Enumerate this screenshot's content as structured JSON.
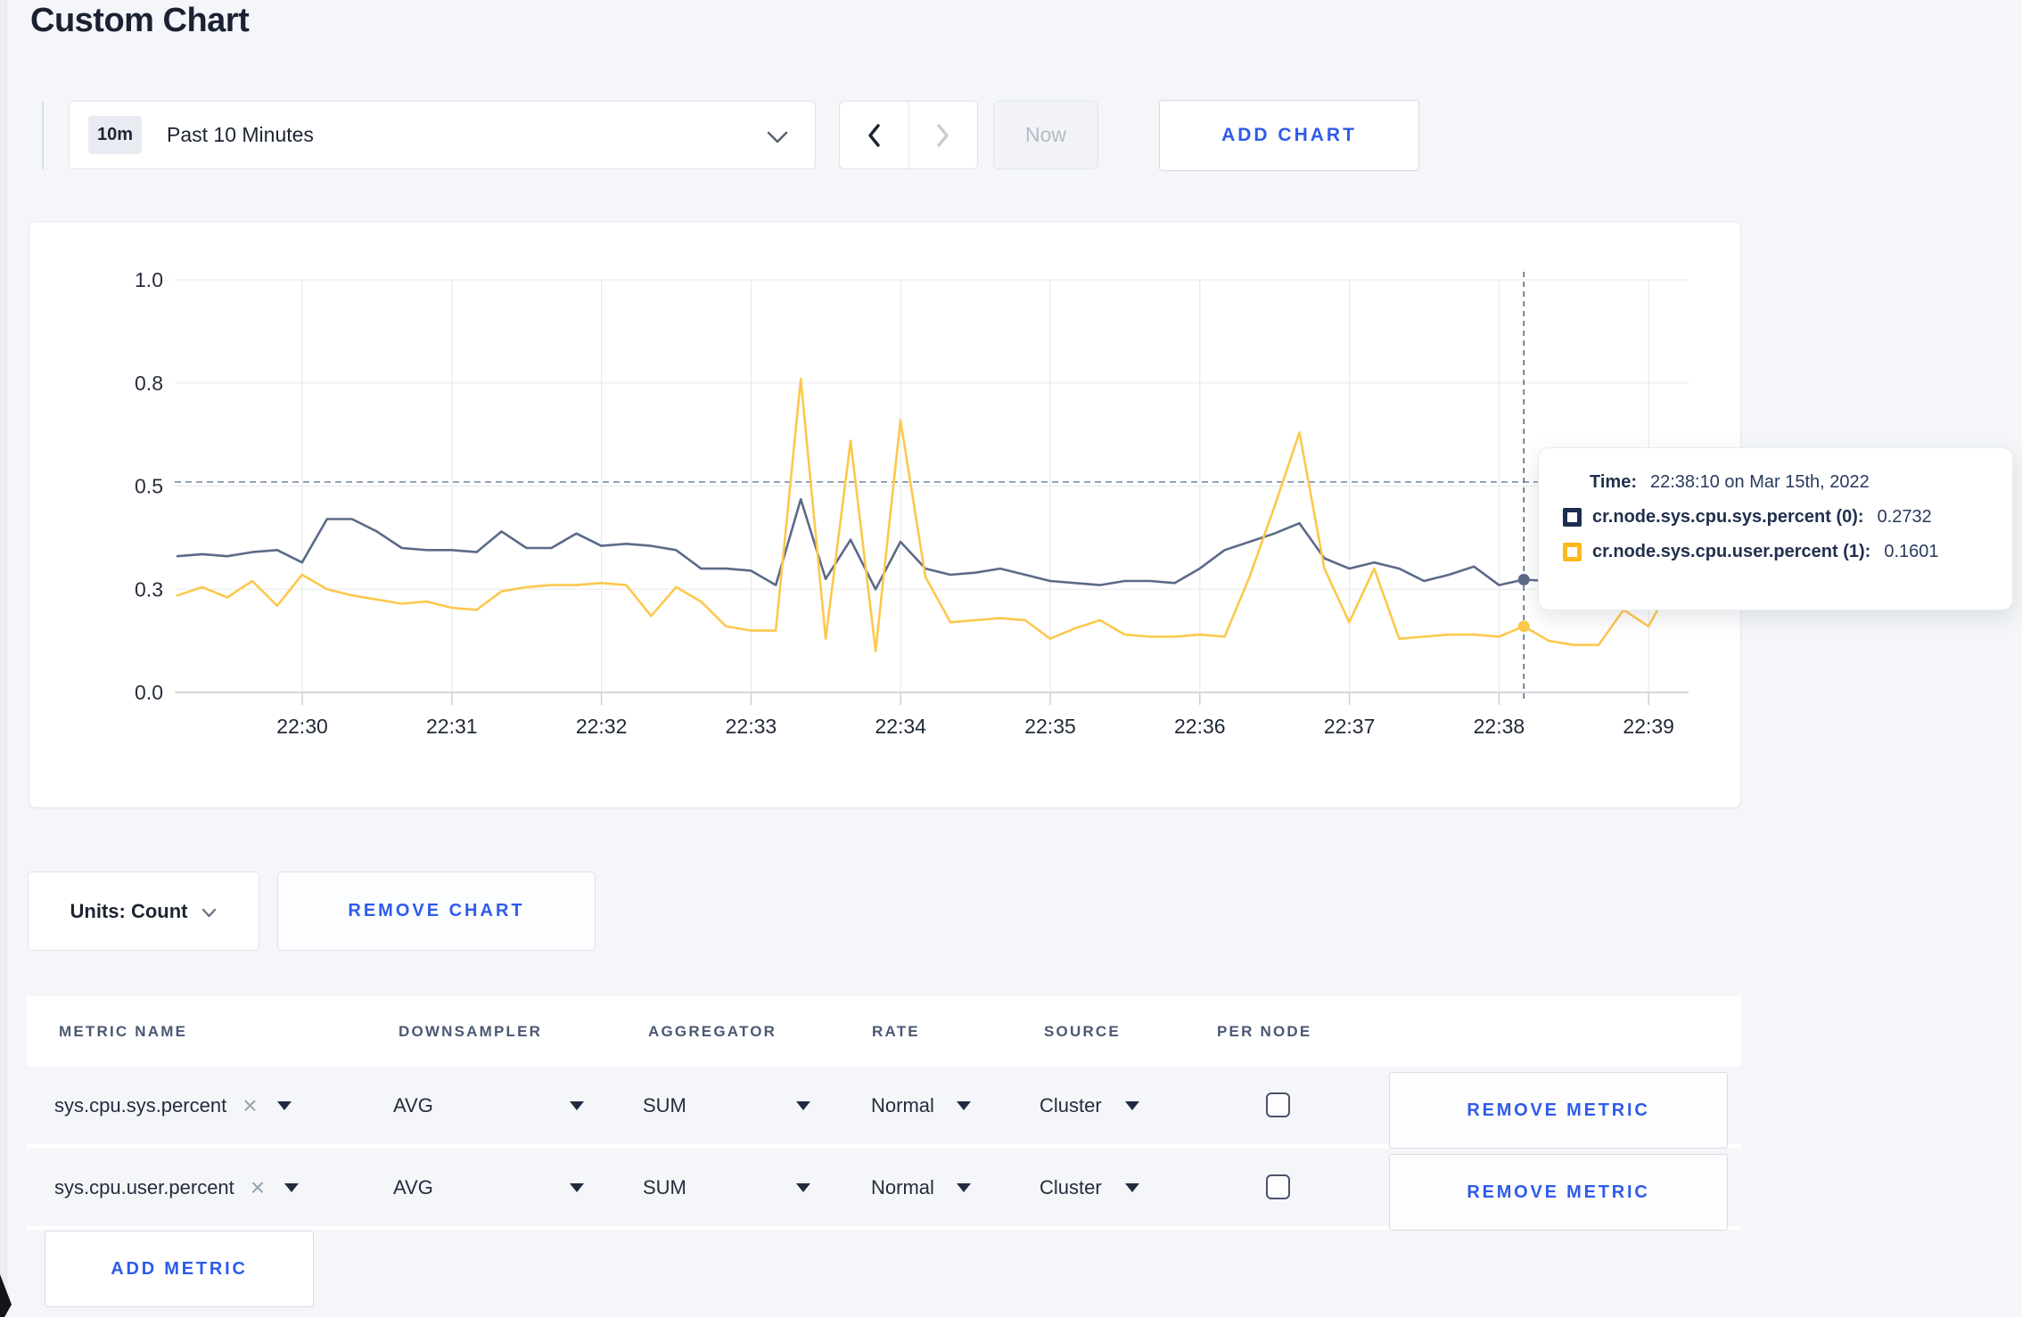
{
  "page": {
    "title": "Custom Chart"
  },
  "toolbar": {
    "time_window_badge": "10m",
    "time_window_label": "Past 10 Minutes",
    "now_label": "Now",
    "add_chart_label": "ADD CHART"
  },
  "units": {
    "units_label": "Units: Count",
    "remove_chart_label": "REMOVE CHART"
  },
  "tooltip": {
    "time_label": "Time:",
    "time_value": "22:38:10 on Mar 15th, 2022",
    "rows": [
      {
        "name": "cr.node.sys.cpu.sys.percent (0):",
        "value": "0.2732",
        "swatch": "#1d2d52"
      },
      {
        "name": "cr.node.sys.cpu.user.percent (1):",
        "value": "0.1601",
        "swatch": "#fdb81c"
      }
    ]
  },
  "chart_data": {
    "type": "line",
    "title": "",
    "xlabel": "",
    "ylabel": "",
    "ylim": [
      0,
      1
    ],
    "grid": true,
    "x_start": "22:29:10",
    "x_step_seconds": 10,
    "x_tick_labels": [
      "22:30",
      "22:31",
      "22:32",
      "22:33",
      "22:34",
      "22:35",
      "22:36",
      "22:37",
      "22:38",
      "22:39"
    ],
    "y_tick_labels": [
      "0.0",
      "0.3",
      "0.5",
      "0.8",
      "1.0"
    ],
    "y_tick_values": [
      0,
      0.25,
      0.5,
      0.75,
      1.0
    ],
    "crosshair": {
      "time": "22:38:10",
      "index": 54,
      "hover_line_value": 0.51
    },
    "series": [
      {
        "name": "cr.node.sys.cpu.sys.percent",
        "color": "#5b6a88",
        "values": [
          0.33,
          0.335,
          0.33,
          0.34,
          0.345,
          0.315,
          0.42,
          0.42,
          0.39,
          0.35,
          0.345,
          0.345,
          0.34,
          0.39,
          0.35,
          0.35,
          0.385,
          0.355,
          0.36,
          0.355,
          0.345,
          0.3,
          0.3,
          0.295,
          0.26,
          0.468,
          0.275,
          0.37,
          0.25,
          0.365,
          0.3,
          0.285,
          0.29,
          0.3,
          0.285,
          0.27,
          0.265,
          0.26,
          0.27,
          0.27,
          0.265,
          0.3,
          0.345,
          0.365,
          0.385,
          0.41,
          0.325,
          0.3,
          0.315,
          0.3,
          0.27,
          0.285,
          0.305,
          0.26,
          0.2732,
          0.27,
          0.3,
          0.29,
          0.3,
          0.31,
          0.3
        ]
      },
      {
        "name": "cr.node.sys.cpu.user.percent",
        "color": "#fcc84c",
        "values": [
          0.235,
          0.255,
          0.23,
          0.27,
          0.21,
          0.285,
          0.25,
          0.235,
          0.225,
          0.215,
          0.22,
          0.205,
          0.2,
          0.245,
          0.255,
          0.26,
          0.26,
          0.265,
          0.26,
          0.185,
          0.255,
          0.22,
          0.16,
          0.15,
          0.15,
          0.76,
          0.13,
          0.61,
          0.1,
          0.66,
          0.28,
          0.17,
          0.175,
          0.18,
          0.175,
          0.13,
          0.155,
          0.175,
          0.14,
          0.135,
          0.135,
          0.14,
          0.135,
          0.28,
          0.45,
          0.63,
          0.3,
          0.17,
          0.3,
          0.13,
          0.135,
          0.14,
          0.14,
          0.135,
          0.1601,
          0.125,
          0.115,
          0.115,
          0.2,
          0.16,
          0.27
        ]
      }
    ]
  },
  "metrics_table": {
    "headers": [
      "METRIC NAME",
      "DOWNSAMPLER",
      "AGGREGATOR",
      "RATE",
      "SOURCE",
      "PER NODE"
    ],
    "rows": [
      {
        "metric": "sys.cpu.sys.percent",
        "downsampler": "AVG",
        "aggregator": "SUM",
        "rate": "Normal",
        "source": "Cluster",
        "per_node_checked": false,
        "remove_label": "REMOVE METRIC"
      },
      {
        "metric": "sys.cpu.user.percent",
        "downsampler": "AVG",
        "aggregator": "SUM",
        "rate": "Normal",
        "source": "Cluster",
        "per_node_checked": false,
        "remove_label": "REMOVE METRIC"
      }
    ],
    "add_metric_label": "ADD METRIC"
  },
  "colors": {
    "accent_blue": "#2e5bea",
    "page_background": "#f4f6f9",
    "series_sys": "#5b6a88",
    "series_user": "#fcc84c",
    "gridline": "#e7e8ec",
    "axis": "#c9ccd3"
  }
}
